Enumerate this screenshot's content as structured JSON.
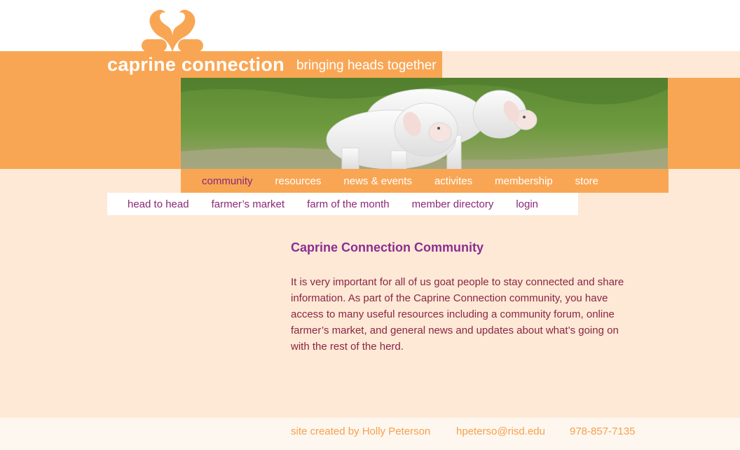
{
  "brand": {
    "name": "caprine connection",
    "tagline": "bringing heads together"
  },
  "colors": {
    "orange": "#f9a654",
    "cream": "#fde9d5",
    "purple": "#8b2d91",
    "maroon": "#8b2545"
  },
  "hero": {
    "icon": "goats-photo"
  },
  "main_nav": {
    "items": [
      {
        "label": "community",
        "active": true
      },
      {
        "label": "resources",
        "active": false
      },
      {
        "label": "news & events",
        "active": false
      },
      {
        "label": "activites",
        "active": false
      },
      {
        "label": "membership",
        "active": false
      },
      {
        "label": "store",
        "active": false
      }
    ]
  },
  "sub_nav": {
    "items": [
      {
        "label": "head to head"
      },
      {
        "label": "farmer’s market"
      },
      {
        "label": "farm of the month"
      },
      {
        "label": "member directory"
      },
      {
        "label": "login"
      }
    ]
  },
  "content": {
    "title": "Caprine Connection Community",
    "body": "It is very important for all of us goat people to stay connected and share information. As part of the Caprine Connection community, you have access to many useful resources including a community forum, online farmer’s market, and general news and updates about what’s going on with the rest of the herd."
  },
  "footer": {
    "credit": "site created by Holly Peterson",
    "email": "hpeterso@risd.edu",
    "phone": "978-857-7135"
  }
}
